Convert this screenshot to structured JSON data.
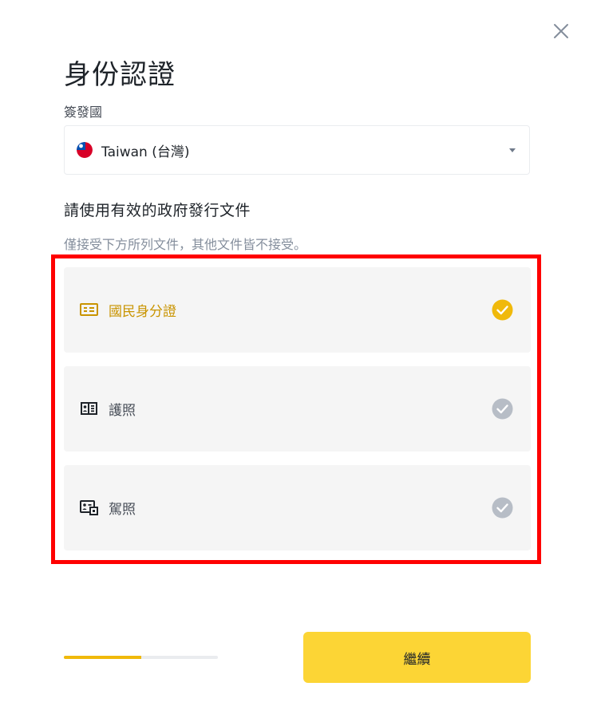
{
  "dialog": {
    "title": "身份認證",
    "close_icon": "close-icon"
  },
  "country": {
    "label": "簽發國",
    "value": "Taiwan (台灣)",
    "flag_icon": "taiwan-flag-icon",
    "caret_icon": "caret-down-icon"
  },
  "documents": {
    "heading": "請使用有效的政府發行文件",
    "note": "僅接受下方所列文件，其他文件皆不接受。",
    "items": [
      {
        "label": "國民身分證",
        "icon": "id-card-icon",
        "selected": true
      },
      {
        "label": "護照",
        "icon": "passport-icon",
        "selected": false
      },
      {
        "label": "駕照",
        "icon": "driver-license-icon",
        "selected": false
      }
    ]
  },
  "footer": {
    "progress_fraction": 0.5,
    "continue_label": "繼續"
  },
  "colors": {
    "accent": "#fcd535",
    "selected_text": "#c99400",
    "selected_check": "#f0b90b",
    "unselected_check": "#b7bdc6",
    "card_bg": "#f5f5f5",
    "highlight_border": "#ff0000"
  }
}
